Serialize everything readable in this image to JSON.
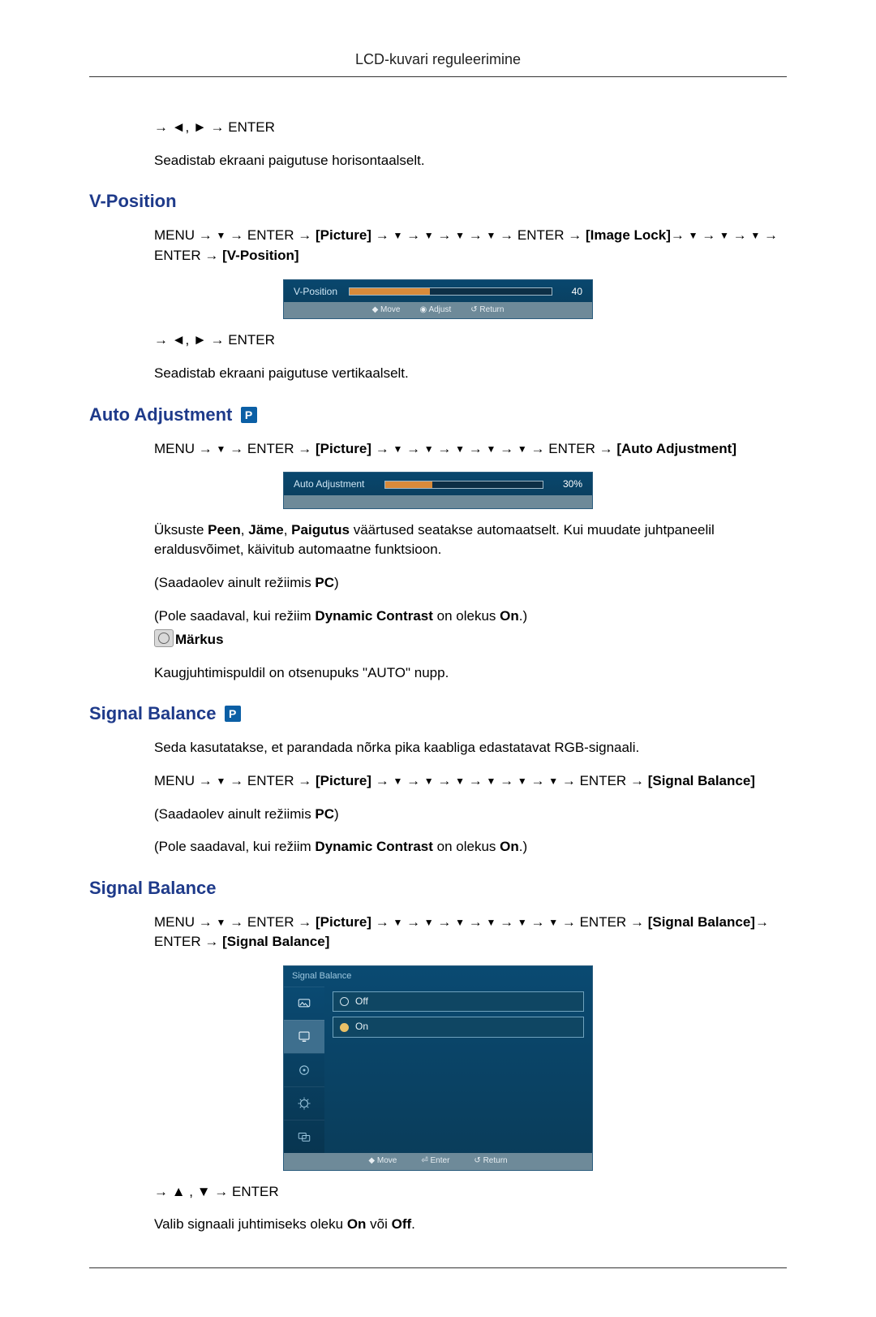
{
  "header": {
    "title": "LCD-kuvari reguleerimine"
  },
  "glyphs": {
    "arrow_right": "→",
    "tri_left": "◄",
    "tri_right": "►",
    "tri_down": "▼",
    "tri_up": "▲",
    "comma": ", "
  },
  "labels": {
    "menu": "MENU",
    "enter": "ENTER",
    "picture": "Picture",
    "image_lock": "Image Lock",
    "v_position": "V-Position",
    "auto_adjustment": "Auto Adjustment",
    "signal_balance": "Signal Balance"
  },
  "hpos_tail": {
    "nav_line": "→ ◄, ► → ENTER",
    "desc": "Seadistab ekraani paigutuse horisontaalselt."
  },
  "sections": {
    "vposition": {
      "heading": "V-Position",
      "nav_line2": "→ ◄, ► → ENTER",
      "desc": "Seadistab ekraani paigutuse vertikaalselt.",
      "osd": {
        "label": "V-Position",
        "value": "40",
        "fill_pct": 40,
        "status": {
          "move": "Move",
          "adjust": "Adjust",
          "return": "Return"
        }
      }
    },
    "auto_adjustment": {
      "heading": "Auto Adjustment",
      "p_badge": "P",
      "osd": {
        "label": "Auto Adjustment",
        "value": "30%",
        "fill_pct": 30
      },
      "para1_a": "Üksuste ",
      "para1_b": "Peen",
      "para1_c": ", ",
      "para1_d": "Jäme",
      "para1_e": ", ",
      "para1_f": "Paigutus",
      "para1_g": " väärtused seatakse automaatselt. Kui muudate juhtpaneelil eraldusvõimet, käivitub automaatne funktsioon.",
      "para2_a": "(Saadaolev ainult režiimis ",
      "para2_b": "PC",
      "para2_c": ")",
      "para3_a": "(Pole saadaval, kui režiim ",
      "para3_b": "Dynamic Contrast",
      "para3_c": " on olekus ",
      "para3_d": "On",
      "para3_e": ".)",
      "note_label": "Märkus",
      "note_text": "Kaugjuhtimispuldil on otsenupuks \"AUTO\" nupp."
    },
    "signal_balance_overview": {
      "heading": "Signal Balance",
      "p_badge": "P",
      "desc": "Seda kasutatakse, et parandada nõrka pika kaabliga edastatavat RGB-signaali.",
      "para2_a": "(Saadaolev ainult režiimis ",
      "para2_b": "PC",
      "para2_c": ")",
      "para3_a": "(Pole saadaval, kui režiim ",
      "para3_b": "Dynamic Contrast",
      "para3_c": " on olekus ",
      "para3_d": "On",
      "para3_e": ".)"
    },
    "signal_balance_detail": {
      "heading": "Signal Balance",
      "osd": {
        "title": "Signal Balance",
        "options": {
          "off": "Off",
          "on": "On"
        },
        "selected": "on",
        "status": {
          "move": "Move",
          "enter": "Enter",
          "return": "Return"
        }
      },
      "nav_line2": "→ ▲ , ▼ → ENTER",
      "desc_a": "Valib signaali juhtimiseks oleku ",
      "desc_b": "On",
      "desc_c": " või ",
      "desc_d": "Off",
      "desc_e": "."
    }
  }
}
